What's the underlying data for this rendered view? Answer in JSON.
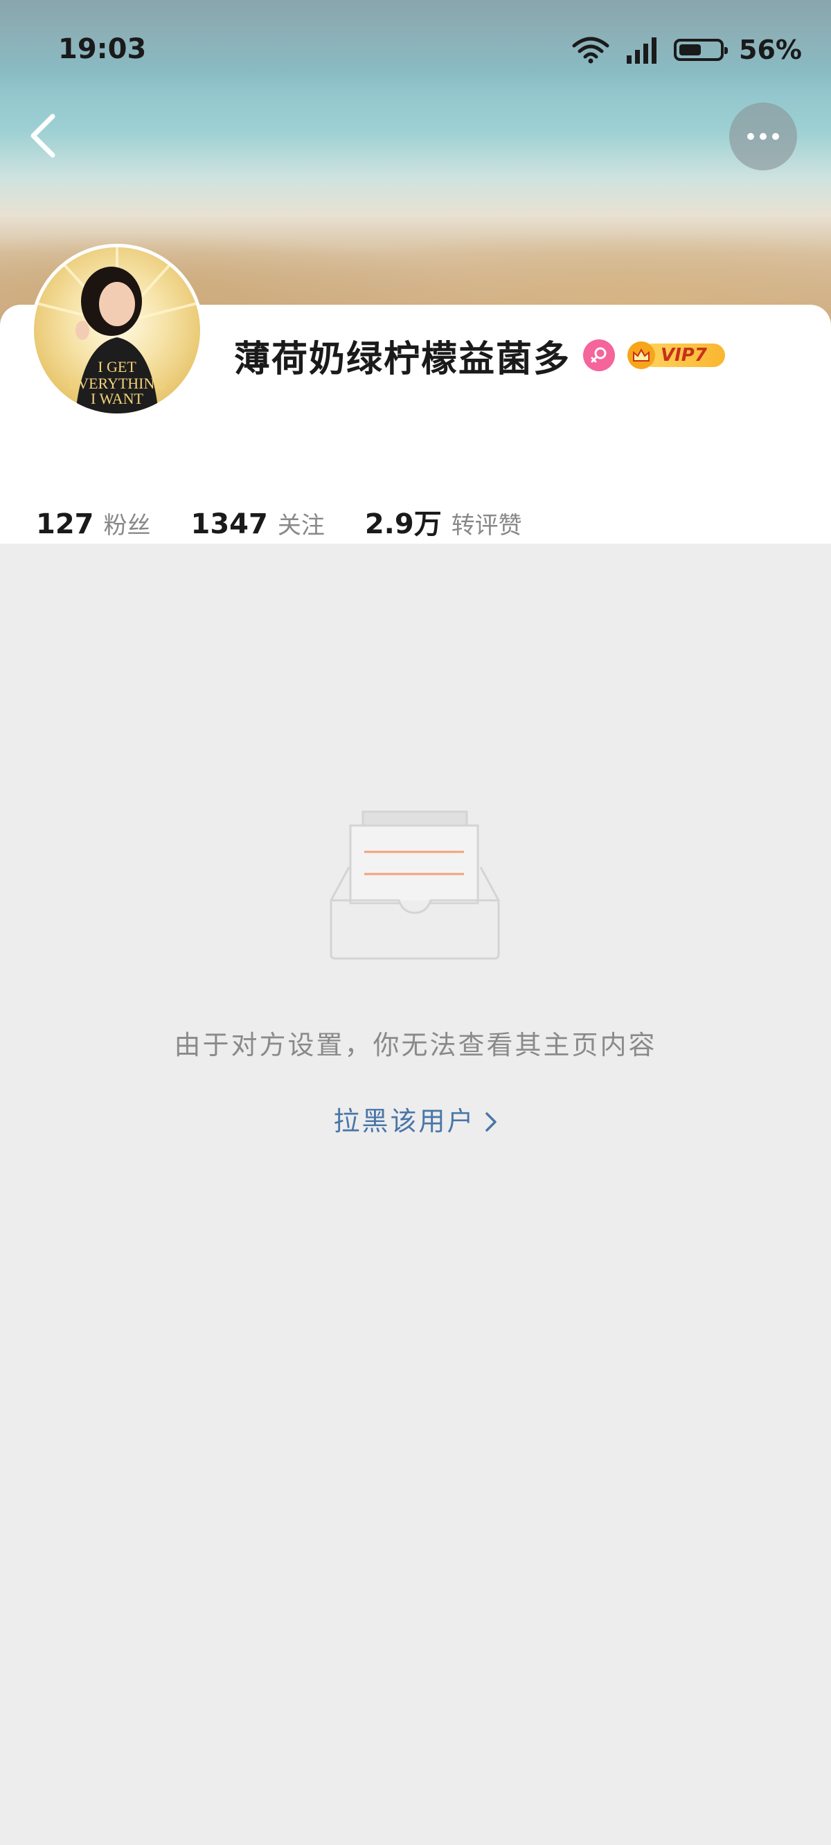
{
  "status_bar": {
    "time": "19:03",
    "battery_percent_text": "56%",
    "battery_level": 0.56,
    "icons": [
      "wifi-icon",
      "signal-icon",
      "battery-icon"
    ]
  },
  "header": {
    "back_icon": "chevron-left-icon",
    "more_icon": "more-dots-icon"
  },
  "profile": {
    "username": "薄荷奶绿柠檬益菌多",
    "gender_icon": "female-icon",
    "vip_label": "VIP7",
    "avatar_caption": "I GET EVERYTHING I WANT",
    "stats": [
      {
        "value": "127",
        "label": "粉丝"
      },
      {
        "value": "1347",
        "label": "关注"
      },
      {
        "value": "2.9万",
        "label": "转评赞"
      }
    ]
  },
  "empty_state": {
    "icon": "empty-inbox-icon",
    "message": "由于对方设置，你无法查看其主页内容",
    "block_link": "拉黑该用户",
    "block_link_icon": "chevron-right-icon"
  },
  "colors": {
    "accent_link": "#4a76a8",
    "female_badge": "#f5649b",
    "vip_gold": "#f9b630",
    "background": "#ededed",
    "illustration_lines": "#f2a27a"
  }
}
